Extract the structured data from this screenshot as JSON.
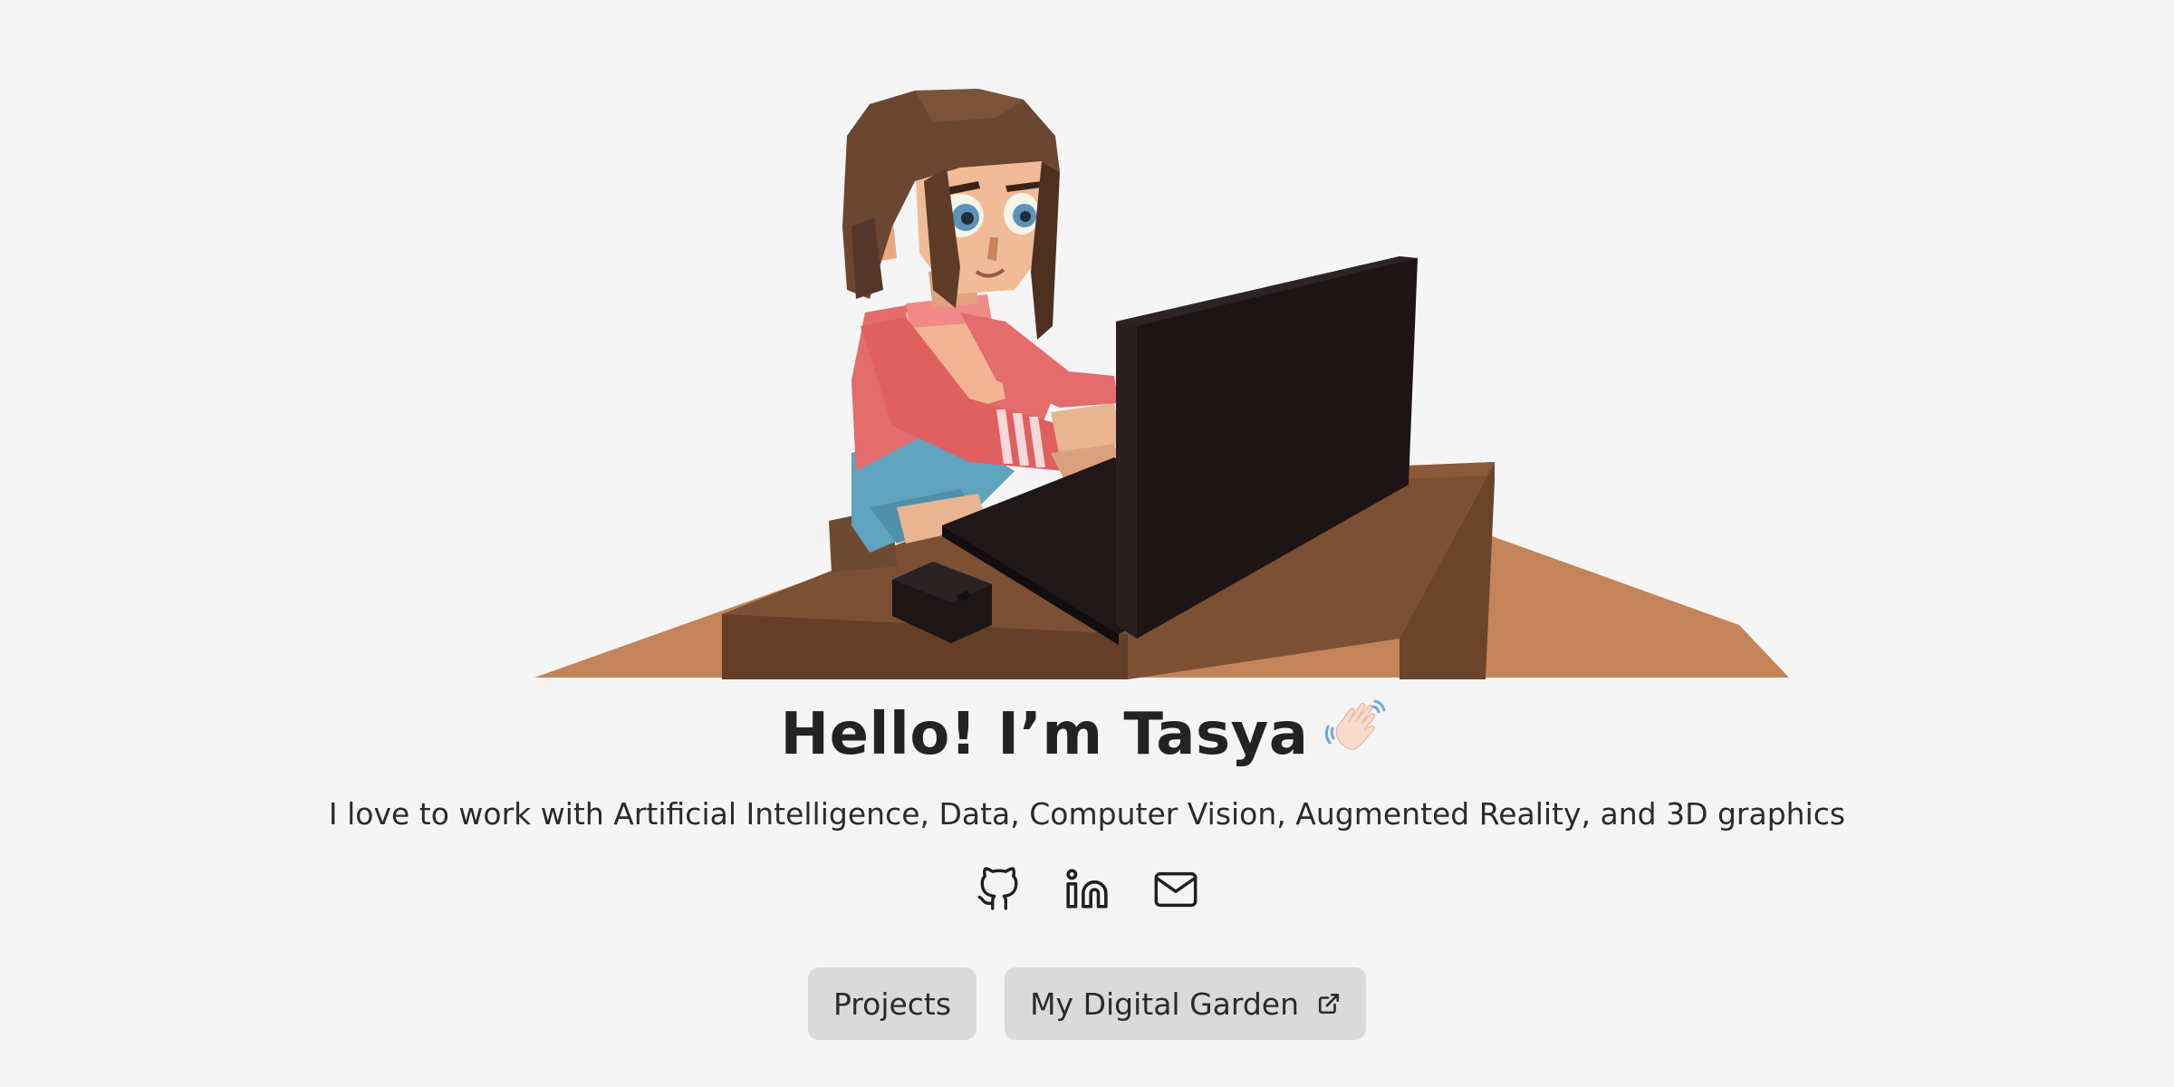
{
  "hero": {
    "title": "Hello! I’m Tasya",
    "wave_emoji": "waving-hand-icon",
    "subtitle": "I love to work with Artificial Intelligence, Data, Computer Vision, Augmented Reality, and 3D graphics"
  },
  "socials": [
    {
      "icon": "github-icon"
    },
    {
      "icon": "linkedin-icon"
    },
    {
      "icon": "mail-icon"
    }
  ],
  "buttons": {
    "projects": "Projects",
    "garden": "My Digital Garden",
    "garden_icon": "external-link-icon"
  },
  "colors": {
    "background": "#f5f5f5",
    "button_bg": "#dadada",
    "text": "#232323",
    "desk": "#7a4f33",
    "floor": "#c4845a",
    "laptop": "#1c1415",
    "sweater": "#e46c6c",
    "hair": "#6b4630"
  }
}
